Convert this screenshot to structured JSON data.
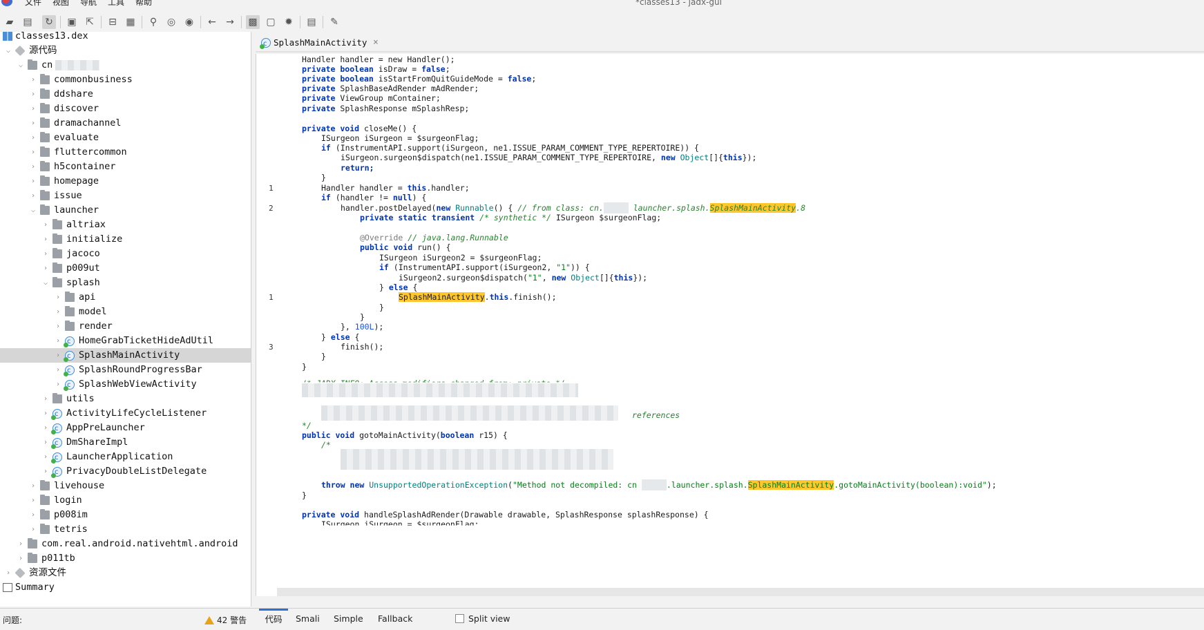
{
  "menubar": {
    "items": [
      "文件",
      "视图",
      "导航",
      "工具",
      "帮助"
    ],
    "window_title": "*classes13 - jadx-gui"
  },
  "toolbar": {
    "icons": [
      "open-icon",
      "add-files-icon",
      "sync-icon",
      "save-icon",
      "export-icon",
      "flatten-icon",
      "package-icon",
      "search-icon",
      "find-usage-icon",
      "find-class-icon",
      "back-icon",
      "forward-icon",
      "sync-tree-icon",
      "bookmark-icon",
      "debug-icon",
      "log-icon",
      "preferences-icon"
    ]
  },
  "tree": {
    "rows": [
      {
        "label": "classes13.dex",
        "type": "dex",
        "level": 0,
        "arrow": ""
      },
      {
        "label": "源代码",
        "type": "pkg",
        "level": 0,
        "arrow": "v"
      },
      {
        "label": "cn",
        "type": "folder",
        "level": 1,
        "arrow": "v",
        "blurred": true
      },
      {
        "label": "commonbusiness",
        "type": "folder",
        "level": 2,
        "arrow": ">"
      },
      {
        "label": "ddshare",
        "type": "folder",
        "level": 2,
        "arrow": ">"
      },
      {
        "label": "discover",
        "type": "folder",
        "level": 2,
        "arrow": ">"
      },
      {
        "label": "dramachannel",
        "type": "folder",
        "level": 2,
        "arrow": ">"
      },
      {
        "label": "evaluate",
        "type": "folder",
        "level": 2,
        "arrow": ">"
      },
      {
        "label": "fluttercommon",
        "type": "folder",
        "level": 2,
        "arrow": ">"
      },
      {
        "label": "h5container",
        "type": "folder",
        "level": 2,
        "arrow": ">"
      },
      {
        "label": "homepage",
        "type": "folder",
        "level": 2,
        "arrow": ">"
      },
      {
        "label": "issue",
        "type": "folder",
        "level": 2,
        "arrow": ">"
      },
      {
        "label": "launcher",
        "type": "folder",
        "level": 2,
        "arrow": "v"
      },
      {
        "label": "altriax",
        "type": "folder",
        "level": 3,
        "arrow": ">"
      },
      {
        "label": "initialize",
        "type": "folder",
        "level": 3,
        "arrow": ">"
      },
      {
        "label": "jacoco",
        "type": "folder",
        "level": 3,
        "arrow": ">"
      },
      {
        "label": "p009ut",
        "type": "folder",
        "level": 3,
        "arrow": ">"
      },
      {
        "label": "splash",
        "type": "folder",
        "level": 3,
        "arrow": "v"
      },
      {
        "label": "api",
        "type": "folder",
        "level": 4,
        "arrow": ">"
      },
      {
        "label": "model",
        "type": "folder",
        "level": 4,
        "arrow": ">"
      },
      {
        "label": "render",
        "type": "folder",
        "level": 4,
        "arrow": ">"
      },
      {
        "label": "HomeGrabTicketHideAdUtil",
        "type": "cls",
        "level": 4,
        "arrow": ">"
      },
      {
        "label": "SplashMainActivity",
        "type": "cls",
        "level": 4,
        "arrow": ">",
        "selected": true
      },
      {
        "label": "SplashRoundProgressBar",
        "type": "cls",
        "level": 4,
        "arrow": ">"
      },
      {
        "label": "SplashWebViewActivity",
        "type": "cls",
        "level": 4,
        "arrow": ">"
      },
      {
        "label": "utils",
        "type": "folder",
        "level": 3,
        "arrow": ">"
      },
      {
        "label": "ActivityLifeCycleListener",
        "type": "cls",
        "level": 3,
        "arrow": ">"
      },
      {
        "label": "AppPreLauncher",
        "type": "cls",
        "level": 3,
        "arrow": ">"
      },
      {
        "label": "DmShareImpl",
        "type": "cls",
        "level": 3,
        "arrow": ">"
      },
      {
        "label": "LauncherApplication",
        "type": "cls",
        "level": 3,
        "arrow": ">"
      },
      {
        "label": "PrivacyDoubleListDelegate",
        "type": "cls",
        "level": 3,
        "arrow": ">"
      },
      {
        "label": "livehouse",
        "type": "folder",
        "level": 2,
        "arrow": ">"
      },
      {
        "label": "login",
        "type": "folder",
        "level": 2,
        "arrow": ">"
      },
      {
        "label": "p008im",
        "type": "folder",
        "level": 2,
        "arrow": ">"
      },
      {
        "label": "tetris",
        "type": "folder",
        "level": 2,
        "arrow": ">"
      },
      {
        "label": "com.real.android.nativehtml.android",
        "type": "folder",
        "level": 1,
        "arrow": ">"
      },
      {
        "label": "p011tb",
        "type": "folder",
        "level": 1,
        "arrow": ">"
      },
      {
        "label": "资源文件",
        "type": "pkg",
        "level": 0,
        "arrow": ">"
      },
      {
        "label": "Summary",
        "type": "summary",
        "level": 0,
        "arrow": ""
      }
    ]
  },
  "editor": {
    "tab_label": "SplashMainActivity",
    "tab_close": "×",
    "gutter": {
      "1": "1",
      "2": "2",
      "3": "3"
    },
    "code": {
      "l0": "Handler handler = new Handler();",
      "l1_kw": "private boolean",
      "l1_rest": " isDraw = ",
      "l1_val": "false",
      "l1_end": ";",
      "l2_kw": "private boolean",
      "l2_rest": " isStartFromQuitGuideMode = ",
      "l2_val": "false",
      "l2_end": ";",
      "l3_kw": "private",
      "l3_rest": " SplashBaseAdRender mAdRender;",
      "l4_kw": "private",
      "l4_rest": " ViewGroup mContainer;",
      "l5_kw": "private",
      "l5_rest": " SplashResponse mSplashResp;",
      "m1_kw": "private void",
      "m1_rest": " closeMe() {",
      "m1_a": "ISurgeon iSurgeon = $surgeonFlag;",
      "m1_b_kw": "if",
      "m1_b_rest": " (InstrumentAPI.support(iSurgeon, ne1.ISSUE_PARAM_COMMENT_TYPE_REPERTOIRE)) {",
      "m1_c_pre": "iSurgeon.surgeon$dispatch(ne1.ISSUE_PARAM_COMMENT_TYPE_REPERTOIRE, ",
      "m1_c_kw": "new",
      "m1_c_ty": " Object",
      "m1_c_mid": "[]{",
      "m1_c_this": "this",
      "m1_c_end": "});",
      "m1_d": "return;",
      "m1_e": "}",
      "m1_f_pre": "Handler handler = ",
      "m1_f_kw": "this",
      "m1_f_end": ".handler;",
      "m1_g_kw": "if",
      "m1_g_mid": " (handler != ",
      "m1_g_null": "null",
      "m1_g_end": ") {",
      "m1_h_pre": "handler.postDelayed(",
      "m1_h_kw": "new",
      "m1_h_ty": " Runnable",
      "m1_h_mid": "() { ",
      "m1_h_cm": "// from class: cn.",
      "m1_h_cm2": " launcher.splash.",
      "m1_h_hl": "SplashMainActivity",
      "m1_h_cm3": ".8",
      "m1_i_kw": "private static transient",
      "m1_i_cm": " /* synthetic */",
      "m1_i_rest": " ISurgeon $surgeonFlag;",
      "m1_j_an": "@Override",
      "m1_j_cm": " // java.lang.Runnable",
      "m1_k_kw": "public void",
      "m1_k_rest": " run() {",
      "m1_l": "ISurgeon iSurgeon2 = $surgeonFlag;",
      "m1_m_kw": "if",
      "m1_m_mid": " (InstrumentAPI.support(iSurgeon2, ",
      "m1_m_str": "\"1\"",
      "m1_m_end": ")) {",
      "m1_n_pre": "iSurgeon2.surgeon$dispatch(",
      "m1_n_str": "\"1\"",
      "m1_n_mid": ", ",
      "m1_n_kw": "new",
      "m1_n_ty": " Object",
      "m1_n_mid2": "[]{",
      "m1_n_this": "this",
      "m1_n_end": "});",
      "m1_o_pre": "} ",
      "m1_o_kw": "else",
      "m1_o_end": " {",
      "m1_p_hl": "SplashMainActivity",
      "m1_p_dot": ".",
      "m1_p_this": "this",
      "m1_p_end": ".finish();",
      "m1_q": "}",
      "m1_r": "}",
      "m1_s_pre": "}, ",
      "m1_s_num": "100L",
      "m1_s_end": ");",
      "m1_t_pre": "} ",
      "m1_t_kw": "else",
      "m1_t_end": " {",
      "m1_u": "finish();",
      "m1_v": "}",
      "m1_w": "}",
      "c1": "/* JADX INFO: Access modifiers changed from: private */",
      "c2_tail": "references",
      "c3": "*/",
      "m2_kw": "public void",
      "m2_rest": " gotoMainActivity(",
      "m2_ty": "boolean",
      "m2_end": " r15) {",
      "m2_a": "/*",
      "m2_b_kw": "throw new",
      "m2_b_ty": " UnsupportedOperationException",
      "m2_b_pre": "(",
      "m2_b_str1": "\"Method not decompiled: cn ",
      "m2_b_str2": ".launcher.splash.",
      "m2_b_hl": "SplashMainActivity",
      "m2_b_str3": ".gotoMainActivity(boolean):void\"",
      "m2_b_end": ");",
      "m2_c": "}",
      "m3_kw": "private void",
      "m3_rest": " handleSplashAdRender(Drawable drawable, SplashResponse splashResponse) {",
      "m3_a": "ISurgeon iSurgeon = $surgeonFlag;"
    }
  },
  "statusbar": {
    "problems_label": "问题:",
    "warnings": "42 警告",
    "tabs": [
      "代码",
      "Smali",
      "Simple",
      "Fallback"
    ],
    "active_tab": "代码",
    "split_view": "Split view"
  }
}
